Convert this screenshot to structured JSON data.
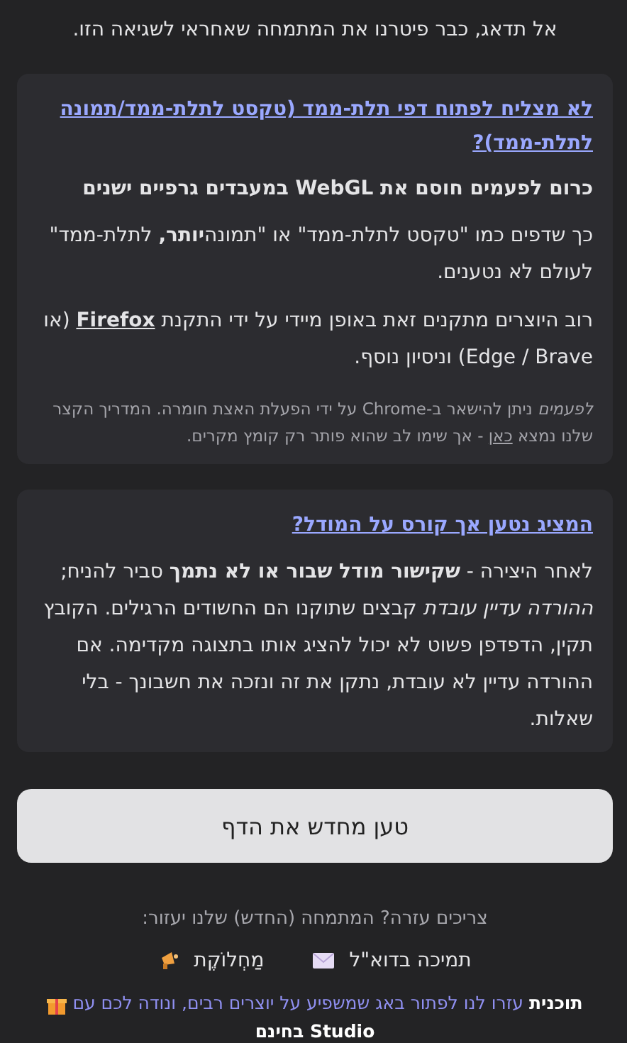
{
  "intro": "אל תדאג, כבר פיטרנו את המתמחה שאחראי לשגיאה הזו.",
  "cards": [
    {
      "title": "לא מצליח לפתוח דפי תלת-ממד (טקסט לתלת-ממד/תמונה לתלת-ממד)?",
      "heading": "כרום לפעמים חוסם את WebGL במעבדים גרפיים ישנים",
      "paragraphs": [
        {
          "kind": "body",
          "parts": [
            {
              "text": "כך שדפים כמו \"טקסט לתלת-ממד\" או \"תמונה**יותר,** לתלת-ממד\" לעולם לא נטענים."
            }
          ]
        },
        {
          "kind": "body",
          "parts": [
            {
              "text": "רוב היוצרים מתקנים זאת באופן מיידי על ידי התקנת "
            },
            {
              "link": "Firefox"
            },
            {
              "text": " (או Edge / Brave) וניסיון נוסף."
            }
          ]
        },
        {
          "kind": "note",
          "parts": [
            {
              "text": "*לפעמים* ניתן להישאר ב-Chrome על ידי הפעלת האצת חומרה. המדריך הקצר שלנו נמצא "
            },
            {
              "link": "כאן"
            },
            {
              "text": " - אך שימו לב שהוא פותר רק קומץ מקרים."
            }
          ]
        }
      ]
    },
    {
      "title": "המציג נטען אך קורס על המודל?",
      "paragraphs": [
        {
          "kind": "body",
          "parts": [
            {
              "text": "לאחר היצירה - **שקישור מודל שבור או לא נתמך** סביר להניח; *ההורדה עדיין עובדת* קבצים שתוקנו הם החשודים הרגילים. הקובץ תקין, הדפדפן פשוט לא יכול להציג אותו בתצוגה מקדימה. אם ההורדה עדיין לא עובדת, נתקן את זה ונזכה את חשבונך - בלי שאלות."
            }
          ]
        }
      ]
    }
  ],
  "reload_button": "טען מחדש את הדף",
  "help": {
    "text": "צריכים עזרה? המתמחה (החדש) שלנו יעזור:",
    "links": [
      {
        "kind": "email",
        "label": "תמיכה בדוא\"ל"
      },
      {
        "kind": "community",
        "label": "מַחְלוֹקֶת"
      }
    ]
  },
  "promo": {
    "text": "**תוכנית** עזרו לנו לפתור באג שמשפיע על יוצרים רבים, ונודה לכם עם",
    "reward": "Studio בחינם"
  }
}
